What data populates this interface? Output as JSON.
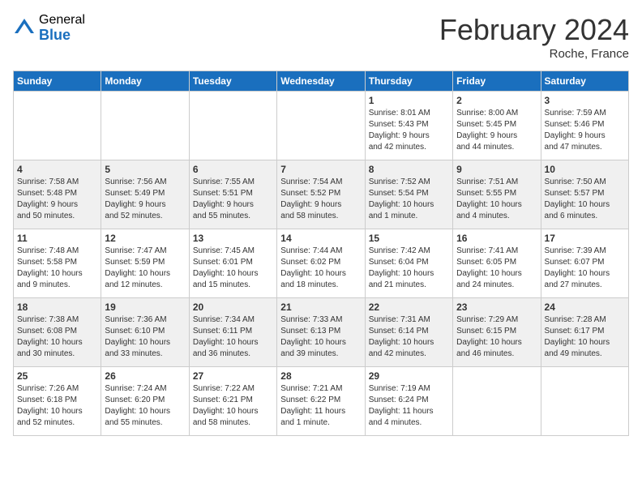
{
  "logo": {
    "general": "General",
    "blue": "Blue"
  },
  "header": {
    "month": "February 2024",
    "location": "Roche, France"
  },
  "days_of_week": [
    "Sunday",
    "Monday",
    "Tuesday",
    "Wednesday",
    "Thursday",
    "Friday",
    "Saturday"
  ],
  "weeks": [
    [
      {
        "day": "",
        "info": ""
      },
      {
        "day": "",
        "info": ""
      },
      {
        "day": "",
        "info": ""
      },
      {
        "day": "",
        "info": ""
      },
      {
        "day": "1",
        "info": "Sunrise: 8:01 AM\nSunset: 5:43 PM\nDaylight: 9 hours\nand 42 minutes."
      },
      {
        "day": "2",
        "info": "Sunrise: 8:00 AM\nSunset: 5:45 PM\nDaylight: 9 hours\nand 44 minutes."
      },
      {
        "day": "3",
        "info": "Sunrise: 7:59 AM\nSunset: 5:46 PM\nDaylight: 9 hours\nand 47 minutes."
      }
    ],
    [
      {
        "day": "4",
        "info": "Sunrise: 7:58 AM\nSunset: 5:48 PM\nDaylight: 9 hours\nand 50 minutes."
      },
      {
        "day": "5",
        "info": "Sunrise: 7:56 AM\nSunset: 5:49 PM\nDaylight: 9 hours\nand 52 minutes."
      },
      {
        "day": "6",
        "info": "Sunrise: 7:55 AM\nSunset: 5:51 PM\nDaylight: 9 hours\nand 55 minutes."
      },
      {
        "day": "7",
        "info": "Sunrise: 7:54 AM\nSunset: 5:52 PM\nDaylight: 9 hours\nand 58 minutes."
      },
      {
        "day": "8",
        "info": "Sunrise: 7:52 AM\nSunset: 5:54 PM\nDaylight: 10 hours\nand 1 minute."
      },
      {
        "day": "9",
        "info": "Sunrise: 7:51 AM\nSunset: 5:55 PM\nDaylight: 10 hours\nand 4 minutes."
      },
      {
        "day": "10",
        "info": "Sunrise: 7:50 AM\nSunset: 5:57 PM\nDaylight: 10 hours\nand 6 minutes."
      }
    ],
    [
      {
        "day": "11",
        "info": "Sunrise: 7:48 AM\nSunset: 5:58 PM\nDaylight: 10 hours\nand 9 minutes."
      },
      {
        "day": "12",
        "info": "Sunrise: 7:47 AM\nSunset: 5:59 PM\nDaylight: 10 hours\nand 12 minutes."
      },
      {
        "day": "13",
        "info": "Sunrise: 7:45 AM\nSunset: 6:01 PM\nDaylight: 10 hours\nand 15 minutes."
      },
      {
        "day": "14",
        "info": "Sunrise: 7:44 AM\nSunset: 6:02 PM\nDaylight: 10 hours\nand 18 minutes."
      },
      {
        "day": "15",
        "info": "Sunrise: 7:42 AM\nSunset: 6:04 PM\nDaylight: 10 hours\nand 21 minutes."
      },
      {
        "day": "16",
        "info": "Sunrise: 7:41 AM\nSunset: 6:05 PM\nDaylight: 10 hours\nand 24 minutes."
      },
      {
        "day": "17",
        "info": "Sunrise: 7:39 AM\nSunset: 6:07 PM\nDaylight: 10 hours\nand 27 minutes."
      }
    ],
    [
      {
        "day": "18",
        "info": "Sunrise: 7:38 AM\nSunset: 6:08 PM\nDaylight: 10 hours\nand 30 minutes."
      },
      {
        "day": "19",
        "info": "Sunrise: 7:36 AM\nSunset: 6:10 PM\nDaylight: 10 hours\nand 33 minutes."
      },
      {
        "day": "20",
        "info": "Sunrise: 7:34 AM\nSunset: 6:11 PM\nDaylight: 10 hours\nand 36 minutes."
      },
      {
        "day": "21",
        "info": "Sunrise: 7:33 AM\nSunset: 6:13 PM\nDaylight: 10 hours\nand 39 minutes."
      },
      {
        "day": "22",
        "info": "Sunrise: 7:31 AM\nSunset: 6:14 PM\nDaylight: 10 hours\nand 42 minutes."
      },
      {
        "day": "23",
        "info": "Sunrise: 7:29 AM\nSunset: 6:15 PM\nDaylight: 10 hours\nand 46 minutes."
      },
      {
        "day": "24",
        "info": "Sunrise: 7:28 AM\nSunset: 6:17 PM\nDaylight: 10 hours\nand 49 minutes."
      }
    ],
    [
      {
        "day": "25",
        "info": "Sunrise: 7:26 AM\nSunset: 6:18 PM\nDaylight: 10 hours\nand 52 minutes."
      },
      {
        "day": "26",
        "info": "Sunrise: 7:24 AM\nSunset: 6:20 PM\nDaylight: 10 hours\nand 55 minutes."
      },
      {
        "day": "27",
        "info": "Sunrise: 7:22 AM\nSunset: 6:21 PM\nDaylight: 10 hours\nand 58 minutes."
      },
      {
        "day": "28",
        "info": "Sunrise: 7:21 AM\nSunset: 6:22 PM\nDaylight: 11 hours\nand 1 minute."
      },
      {
        "day": "29",
        "info": "Sunrise: 7:19 AM\nSunset: 6:24 PM\nDaylight: 11 hours\nand 4 minutes."
      },
      {
        "day": "",
        "info": ""
      },
      {
        "day": "",
        "info": ""
      }
    ]
  ]
}
